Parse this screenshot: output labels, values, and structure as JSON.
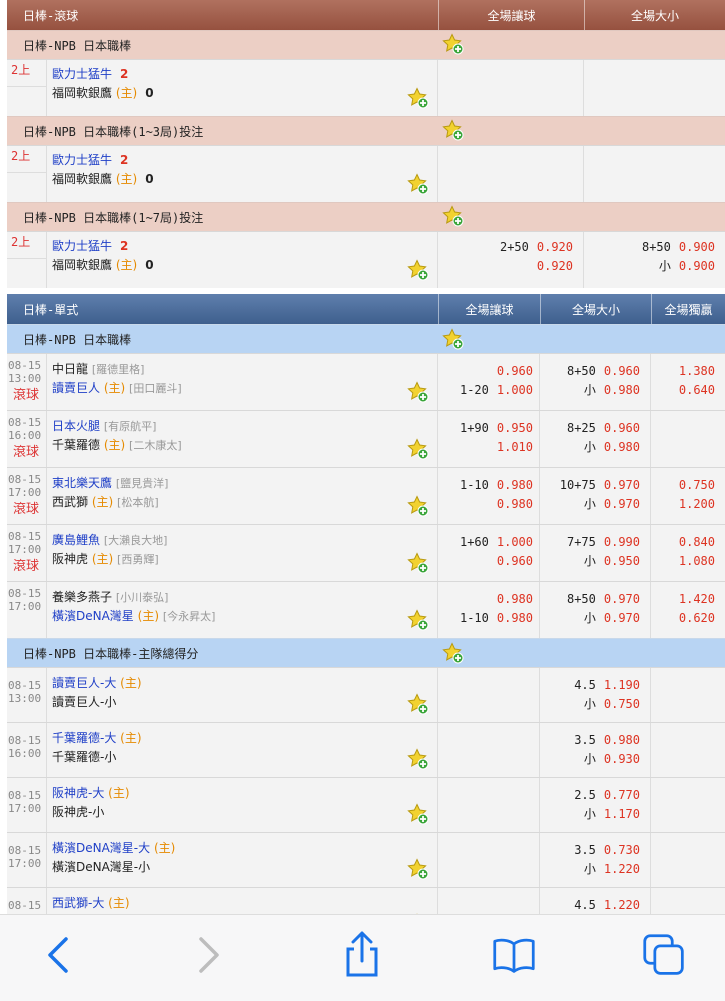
{
  "live": {
    "header": {
      "title": "日棒-滾球",
      "col1": "全場讓球",
      "col2": "全場大小"
    },
    "groups": [
      {
        "league": "日棒-NPB 日本職棒",
        "inning": "2上",
        "team1": "歐力士猛牛",
        "score1": "2",
        "team2": "福岡軟銀鷹",
        "home": "(主)",
        "score2": "0",
        "hdp": {
          "h1": "",
          "o1": "",
          "h2": "",
          "o2": ""
        },
        "ou": {
          "h1": "",
          "o1": "",
          "h2": "",
          "o2": ""
        }
      },
      {
        "league": "日棒-NPB 日本職棒(1~3局)投注",
        "inning": "2上",
        "team1": "歐力士猛牛",
        "score1": "2",
        "team2": "福岡軟銀鷹",
        "home": "(主)",
        "score2": "0",
        "hdp": {
          "h1": "",
          "o1": "",
          "h2": "",
          "o2": ""
        },
        "ou": {
          "h1": "",
          "o1": "",
          "h2": "",
          "o2": ""
        }
      },
      {
        "league": "日棒-NPB 日本職棒(1~7局)投注",
        "inning": "2上",
        "team1": "歐力士猛牛",
        "score1": "2",
        "team2": "福岡軟銀鷹",
        "home": "(主)",
        "score2": "0",
        "hdp": {
          "h1": "2+50",
          "o1": "0.920",
          "h2": "",
          "o2": "0.920"
        },
        "ou": {
          "h1": "8+50",
          "o1": "0.900",
          "h2": "小",
          "o2": "0.900"
        }
      }
    ]
  },
  "single": {
    "header": {
      "title": "日棒-單式",
      "col1": "全場讓球",
      "col2": "全場大小",
      "col3": "全場獨贏"
    },
    "league1": "日棒-NPB 日本職棒",
    "matches": [
      {
        "date": "08-15",
        "time": "13:00",
        "live": "滾球",
        "t1": "中日龍",
        "p1": "[羅德里格]",
        "t2": "讀賣巨人",
        "home": "(主)",
        "p2": "[田口麗斗]",
        "t1blue": false,
        "hdp": [
          "",
          "0.960",
          "1-20",
          "1.000"
        ],
        "ou": [
          "8+50",
          "0.960",
          "小",
          "0.980"
        ],
        "ml": [
          "1.380",
          "0.640"
        ]
      },
      {
        "date": "08-15",
        "time": "16:00",
        "live": "滾球",
        "t1": "日本火腿",
        "p1": "[有原航平]",
        "t2": "千葉羅德",
        "home": "(主)",
        "p2": "[二木康太]",
        "t1blue": true,
        "hdp": [
          "1+90",
          "0.950",
          "",
          "1.010"
        ],
        "ou": [
          "8+25",
          "0.960",
          "小",
          "0.980"
        ],
        "ml": [
          "",
          ""
        ]
      },
      {
        "date": "08-15",
        "time": "17:00",
        "live": "滾球",
        "t1": "東北樂天鷹",
        "p1": "[鹽見貴洋]",
        "t2": "西武獅",
        "home": "(主)",
        "p2": "[松本航]",
        "t1blue": true,
        "hdp": [
          "1-10",
          "0.980",
          "",
          "0.980"
        ],
        "ou": [
          "10+75",
          "0.970",
          "小",
          "0.970"
        ],
        "ml": [
          "0.750",
          "1.200"
        ]
      },
      {
        "date": "08-15",
        "time": "17:00",
        "live": "滾球",
        "t1": "廣島鯉魚",
        "p1": "[大瀨良大地]",
        "t2": "阪神虎",
        "home": "(主)",
        "p2": "[西勇輝]",
        "t1blue": true,
        "hdp": [
          "1+60",
          "1.000",
          "",
          "0.960"
        ],
        "ou": [
          "7+75",
          "0.990",
          "小",
          "0.950"
        ],
        "ml": [
          "0.840",
          "1.080"
        ]
      },
      {
        "date": "08-15",
        "time": "17:00",
        "live": "",
        "t1": "養樂多燕子",
        "p1": "[小川泰弘]",
        "t2": "橫濱DeNA灣星",
        "home": "(主)",
        "p2": "[今永昇太]",
        "t1blue": false,
        "hdp": [
          "",
          "0.980",
          "1-10",
          "0.980"
        ],
        "ou": [
          "8+50",
          "0.970",
          "小",
          "0.970"
        ],
        "ml": [
          "1.420",
          "0.620"
        ]
      }
    ],
    "league2": "日棒-NPB 日本職棒-主隊總得分",
    "totals": [
      {
        "date": "08-15",
        "time": "13:00",
        "t1": "讀賣巨人-大",
        "home": "(主)",
        "t2": "讀賣巨人-小",
        "line": "4.5",
        "o1": "1.190",
        "u": "小",
        "o2": "0.750"
      },
      {
        "date": "08-15",
        "time": "16:00",
        "t1": "千葉羅德-大",
        "home": "(主)",
        "t2": "千葉羅德-小",
        "line": "3.5",
        "o1": "0.980",
        "u": "小",
        "o2": "0.930"
      },
      {
        "date": "08-15",
        "time": "17:00",
        "t1": "阪神虎-大",
        "home": "(主)",
        "t2": "阪神虎-小",
        "line": "2.5",
        "o1": "0.770",
        "u": "小",
        "o2": "1.170"
      },
      {
        "date": "08-15",
        "time": "17:00",
        "t1": "橫濱DeNA灣星-大",
        "home": "(主)",
        "t2": "橫濱DeNA灣星-小",
        "line": "3.5",
        "o1": "0.730",
        "u": "小",
        "o2": "1.220"
      },
      {
        "date": "08-15",
        "time": "",
        "t1": "西武獅-大",
        "home": "(主)",
        "t2": "",
        "line": "4.5",
        "o1": "1.220",
        "u": "",
        "o2": ""
      }
    ]
  },
  "browser": {
    "icons": [
      "back-icon",
      "forward-icon",
      "share-icon",
      "bookmarks-icon",
      "tabs-icon"
    ]
  }
}
